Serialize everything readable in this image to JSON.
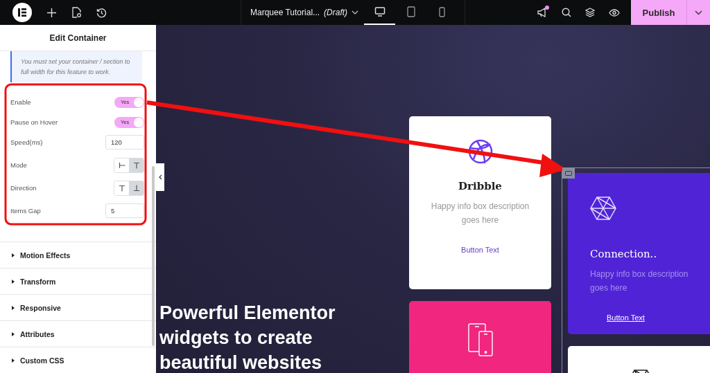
{
  "toolbar": {
    "document_title": "Marquee Tutorial...",
    "document_status": "(Draft)",
    "devices": [
      {
        "kind": "desktop",
        "selected": true
      },
      {
        "kind": "tablet",
        "selected": false
      },
      {
        "kind": "mobile",
        "selected": false
      }
    ],
    "notifications_unread": true,
    "publish_label": "Publish"
  },
  "panel": {
    "title": "Edit Container",
    "notice": "You must set your container / section to full width for this feature to work.",
    "controls": [
      {
        "kind": "switch",
        "label": "Enable",
        "on": true,
        "switch_text": "Yes"
      },
      {
        "kind": "switch",
        "label": "Pause on Hover",
        "on": true,
        "switch_text": "Yes"
      },
      {
        "kind": "number",
        "label": "Speed(ms)",
        "value": "120"
      },
      {
        "kind": "choice",
        "label": "Mode",
        "options": [
          {
            "selected": false
          },
          {
            "selected": true
          }
        ]
      },
      {
        "kind": "choice",
        "label": "Direction",
        "options": [
          {
            "selected": false
          },
          {
            "selected": true
          }
        ]
      },
      {
        "kind": "number",
        "label": "Items Gap",
        "value": "5"
      }
    ],
    "sections": [
      {
        "label": "Motion Effects",
        "expanded": false
      },
      {
        "label": "Transform",
        "expanded": false
      },
      {
        "label": "Responsive",
        "expanded": false
      },
      {
        "label": "Attributes",
        "expanded": false
      },
      {
        "label": "Custom CSS",
        "expanded": false
      }
    ]
  },
  "preview": {
    "heading": "Powerful Elementor widgets to create beautiful websites",
    "cards": [
      {
        "kind": "light",
        "title": "Dribble",
        "description": "Happy info box description goes here",
        "button": "Button Text",
        "selected": false
      },
      {
        "kind": "violet",
        "title": "Connection..",
        "description": "Happy info box description goes here",
        "button": "Button Text",
        "selected": true
      },
      {
        "kind": "pink",
        "selected": false
      },
      {
        "kind": "light",
        "selected": false
      }
    ]
  }
}
